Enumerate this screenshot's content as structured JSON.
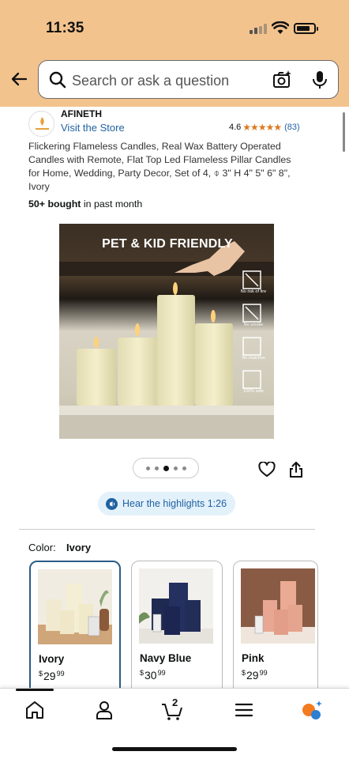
{
  "status_bar": {
    "time": "11:35"
  },
  "search": {
    "placeholder": "Search or ask a question"
  },
  "brand": {
    "name": "AFINETH",
    "store_link": "Visit the Store",
    "logo_text": "AFINETH"
  },
  "rating": {
    "value": "4.6",
    "stars": "★★★★★",
    "count": "(83)"
  },
  "product": {
    "title": "Flickering Flameless Candles, Real Wax Battery Operated Candles with Remote, Flat Top Led Flameless Pillar Candles for Home, Wedding, Party Decor, Set of 4, ⌽ 3\" H 4\" 5\" 6\" 8\", Ivory",
    "bought_bold": "50+ bought",
    "bought_rest": " in past month"
  },
  "hero": {
    "headline": "PET & KID FRIENDLY",
    "badges": [
      "No risk of fire",
      "No smoke",
      "No matches",
      "100% safe"
    ]
  },
  "carousel": {
    "count": 5,
    "active": 2
  },
  "highlights": {
    "label": "Hear the highlights 1:26"
  },
  "color": {
    "label": "Color:",
    "value": "Ivory"
  },
  "swatches": [
    {
      "name": "Ivory",
      "currency": "$",
      "dollars": "29",
      "cents": "99"
    },
    {
      "name": "Navy Blue",
      "currency": "$",
      "dollars": "30",
      "cents": "99"
    },
    {
      "name": "Pink",
      "currency": "$",
      "dollars": "29",
      "cents": "99"
    }
  ],
  "bottom_nav": {
    "cart_count": "2"
  },
  "colors": {
    "header": "#f3c38d",
    "link": "#2162a1",
    "star": "#de7921",
    "selected_border": "#2b5d87"
  }
}
